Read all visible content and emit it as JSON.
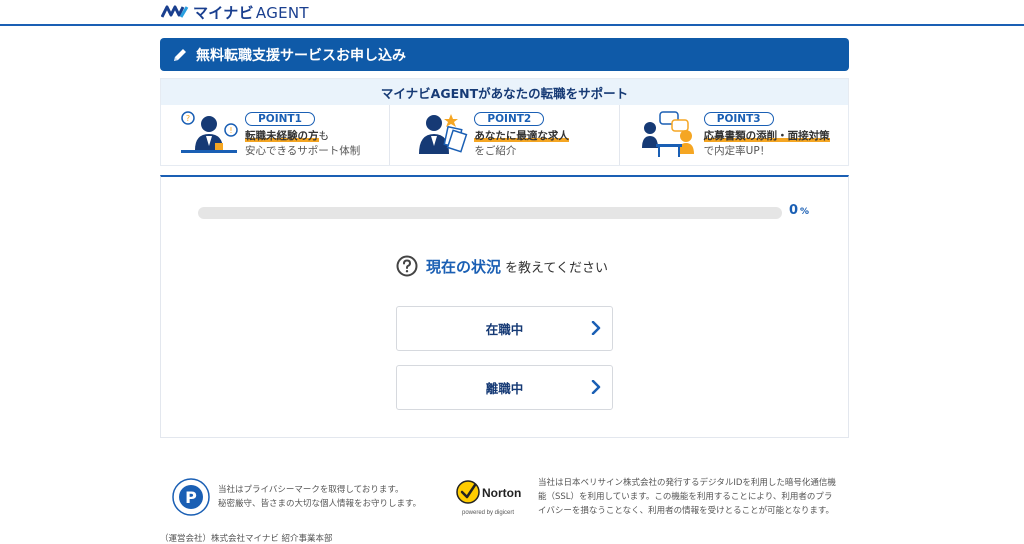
{
  "header": {
    "logo": {
      "icon": "mynavi-logo-mark",
      "brand": "マイナビ",
      "product": "AGENT"
    }
  },
  "title_bar": {
    "icon": "pencil-icon",
    "text": "無料転職支援サービスお申し込み"
  },
  "points": {
    "heading": "マイナビAGENTがあなたの転職をサポート",
    "items": [
      {
        "badge": "POINT1",
        "highlight": "転職未経験の方",
        "suffix": "も",
        "line2": "安心できるサポート体制",
        "icon": "advisor-questions-icon"
      },
      {
        "badge": "POINT2",
        "highlight": "あなたに最適な求人",
        "suffix": "",
        "line2": "をご紹介",
        "icon": "advisor-documents-icon"
      },
      {
        "badge": "POINT3",
        "highlight": "応募書類の添削・面接対策",
        "suffix": "",
        "line2": "で内定率UP！",
        "icon": "interview-meeting-icon"
      }
    ]
  },
  "progress": {
    "value": "0",
    "unit": "%",
    "fraction": 0
  },
  "question": {
    "icon": "question-circle-icon",
    "strong": "現在の状況",
    "rest": "を教えてください"
  },
  "options": [
    {
      "label": "在職中",
      "icon": "chevron-right-icon"
    },
    {
      "label": "離職中",
      "icon": "chevron-right-icon"
    }
  ],
  "footer": {
    "privacy": {
      "line1": "当社はプライバシーマークを取得しております。",
      "line2": "秘密厳守、皆さまの大切な個人情報をお守りします。",
      "icon": "privacy-mark-icon"
    },
    "ssl": {
      "line1": "当社は日本ベリサイン株式会社の発行するデジタルIDを利用した暗号化通信機",
      "line2": "能（SSL）を利用しています。この機能を利用することにより、利用者のプラ",
      "line3": "イバシーを損なうことなく、利用者の情報を受けとることが可能となります。",
      "icon": "norton-seal-icon"
    },
    "company": "（運営会社）株式会社マイナビ 紹介事業本部"
  },
  "colors": {
    "primary": "#0f5aa8",
    "accent": "#f5a623",
    "pale": "#eaf3fb"
  }
}
